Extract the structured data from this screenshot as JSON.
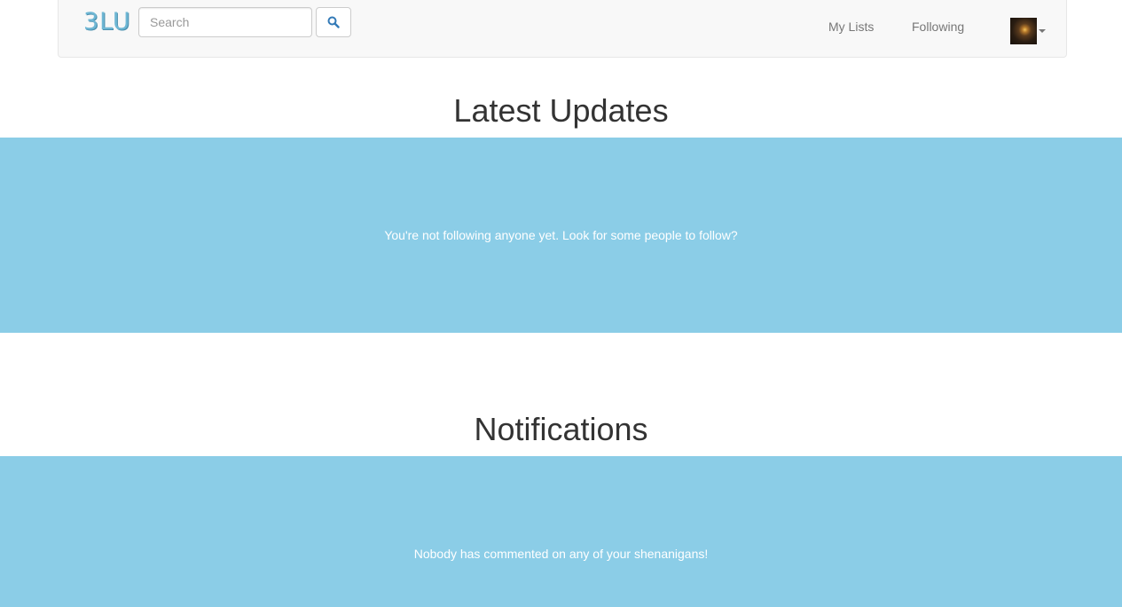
{
  "navbar": {
    "brand": "3LU",
    "search": {
      "placeholder": "Search",
      "value": "",
      "button_icon": "search-icon"
    },
    "links": [
      {
        "label": "My Lists"
      },
      {
        "label": "Following"
      }
    ],
    "user_menu": {
      "avatar": "avatar",
      "caret_icon": "caret-down-icon"
    }
  },
  "sections": {
    "updates": {
      "title": "Latest Updates",
      "message": "You're not following anyone yet. Look for some people to follow?"
    },
    "notifications": {
      "title": "Notifications",
      "message": "Nobody has commented on any of your shenanigans!"
    }
  },
  "colors": {
    "panel_background": "#8bcde7",
    "navbar_background": "#f8f8f8",
    "brand": "#6fb7d4"
  }
}
